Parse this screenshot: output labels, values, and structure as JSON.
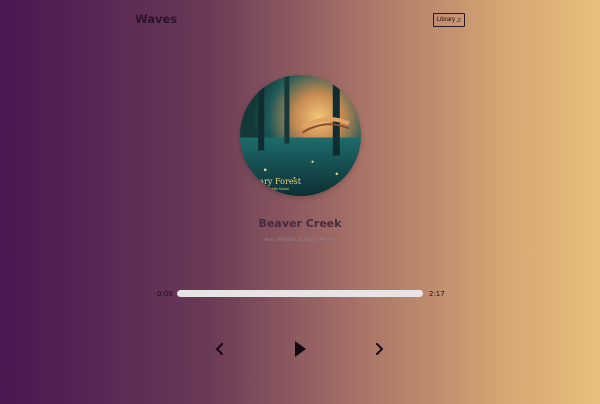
{
  "app": {
    "title": "Waves"
  },
  "header": {
    "library_label": "Library",
    "library_icon": "music-note-icon"
  },
  "track": {
    "title": "Beaver Creek",
    "artist": "Aso, Middle School, Aviino",
    "cover_text_line1": "nary Forest",
    "cover_text_line2": "ool, Aso, Middle School"
  },
  "progress": {
    "current_time": "0:00",
    "total_time": "2:17",
    "fraction": 0.0
  },
  "controls": {
    "prev_icon": "chevron-left-icon",
    "play_icon": "play-icon",
    "next_icon": "chevron-right-icon"
  },
  "colors": {
    "bg_left": "#4b1652",
    "bg_right": "#e8c07b",
    "progress_track": "#e8e4e6",
    "text_dark": "#1d0f19"
  }
}
